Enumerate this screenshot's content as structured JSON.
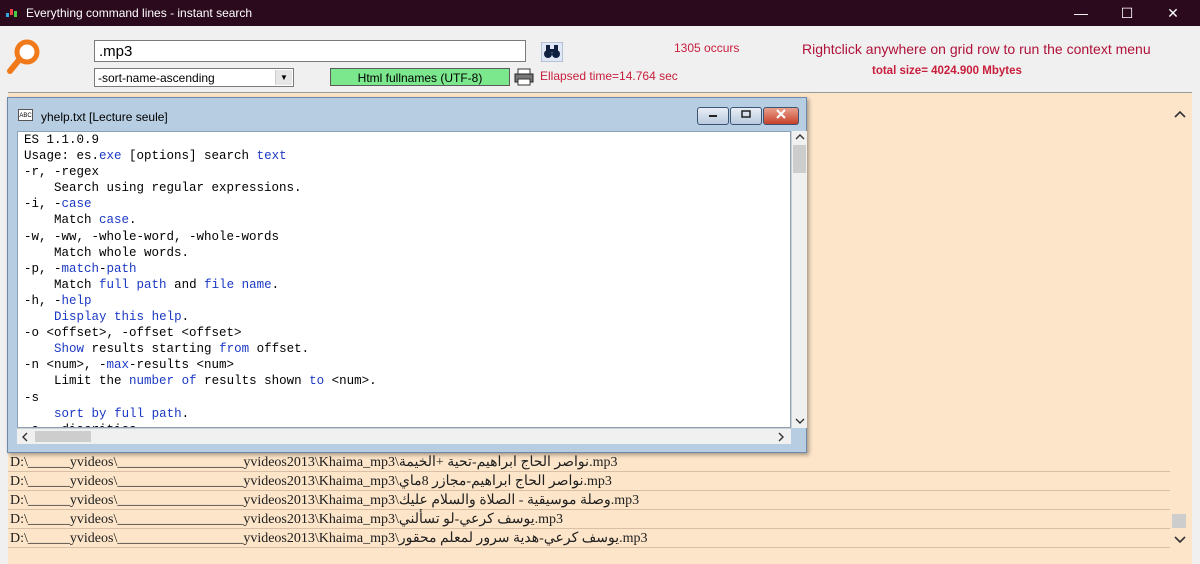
{
  "window": {
    "title": "Everything command lines - instant search"
  },
  "controls": {
    "minimize": "—",
    "maximize": "☐",
    "close": "✕"
  },
  "toolbar": {
    "search_value": ".mp3",
    "sort_value": "-sort-name-ascending",
    "html_button": "Html fullnames (UTF-8)",
    "occurs": "1305 occurs",
    "elapsed": "Ellapsed time=14.764 sec",
    "hint": "Rightclick anywhere on grid row to run the context menu",
    "total_size": "total size= 4024.900 Mbytes"
  },
  "help": {
    "title": "yhelp.txt [Lecture seule]",
    "lines": [
      "ES 1.1.0.9",
      "Usage: es.exe [options] search text",
      "-r, -regex",
      "    Search using regular expressions.",
      "-i, -case",
      "    Match case.",
      "-w, -ww, -whole-word, -whole-words",
      "    Match whole words.",
      "-p, -match-path",
      "    Match full path and file name.",
      "-h, -help",
      "    Display this help.",
      "-o <offset>, -offset <offset>",
      "    Show results starting from offset.",
      "-n <num>, -max-results <num>",
      "    Limit the number of results shown to <num>.",
      "-s",
      "    sort by full path.",
      "-a, -diacritics"
    ]
  },
  "grid": {
    "rows": [
      "D:\\______yvideos\\__________________yvideos2013\\Khaima_mp3\\نواصر الحاج ابراهيم-تحية +الخيمة.mp3",
      "D:\\______yvideos\\__________________yvideos2013\\Khaima_mp3\\نواصر الحاج ابراهيم-مجازر 8ماي.mp3",
      "D:\\______yvideos\\__________________yvideos2013\\Khaima_mp3\\وصلة موسيقية - الصلاة والسلام عليك.mp3",
      "D:\\______yvideos\\__________________yvideos2013\\Khaima_mp3\\يوسف كرعي-لو تسألني.mp3",
      "D:\\______yvideos\\__________________yvideos2013\\Khaima_mp3\\يوسف كرعي-هدية سرور لمعلم محقور.mp3"
    ]
  },
  "colors": {
    "titlebar": "#2b0a1e",
    "grid_bg": "#fde5c9",
    "accent_red": "#c81e3c",
    "html_button_bg": "#7be88e"
  }
}
